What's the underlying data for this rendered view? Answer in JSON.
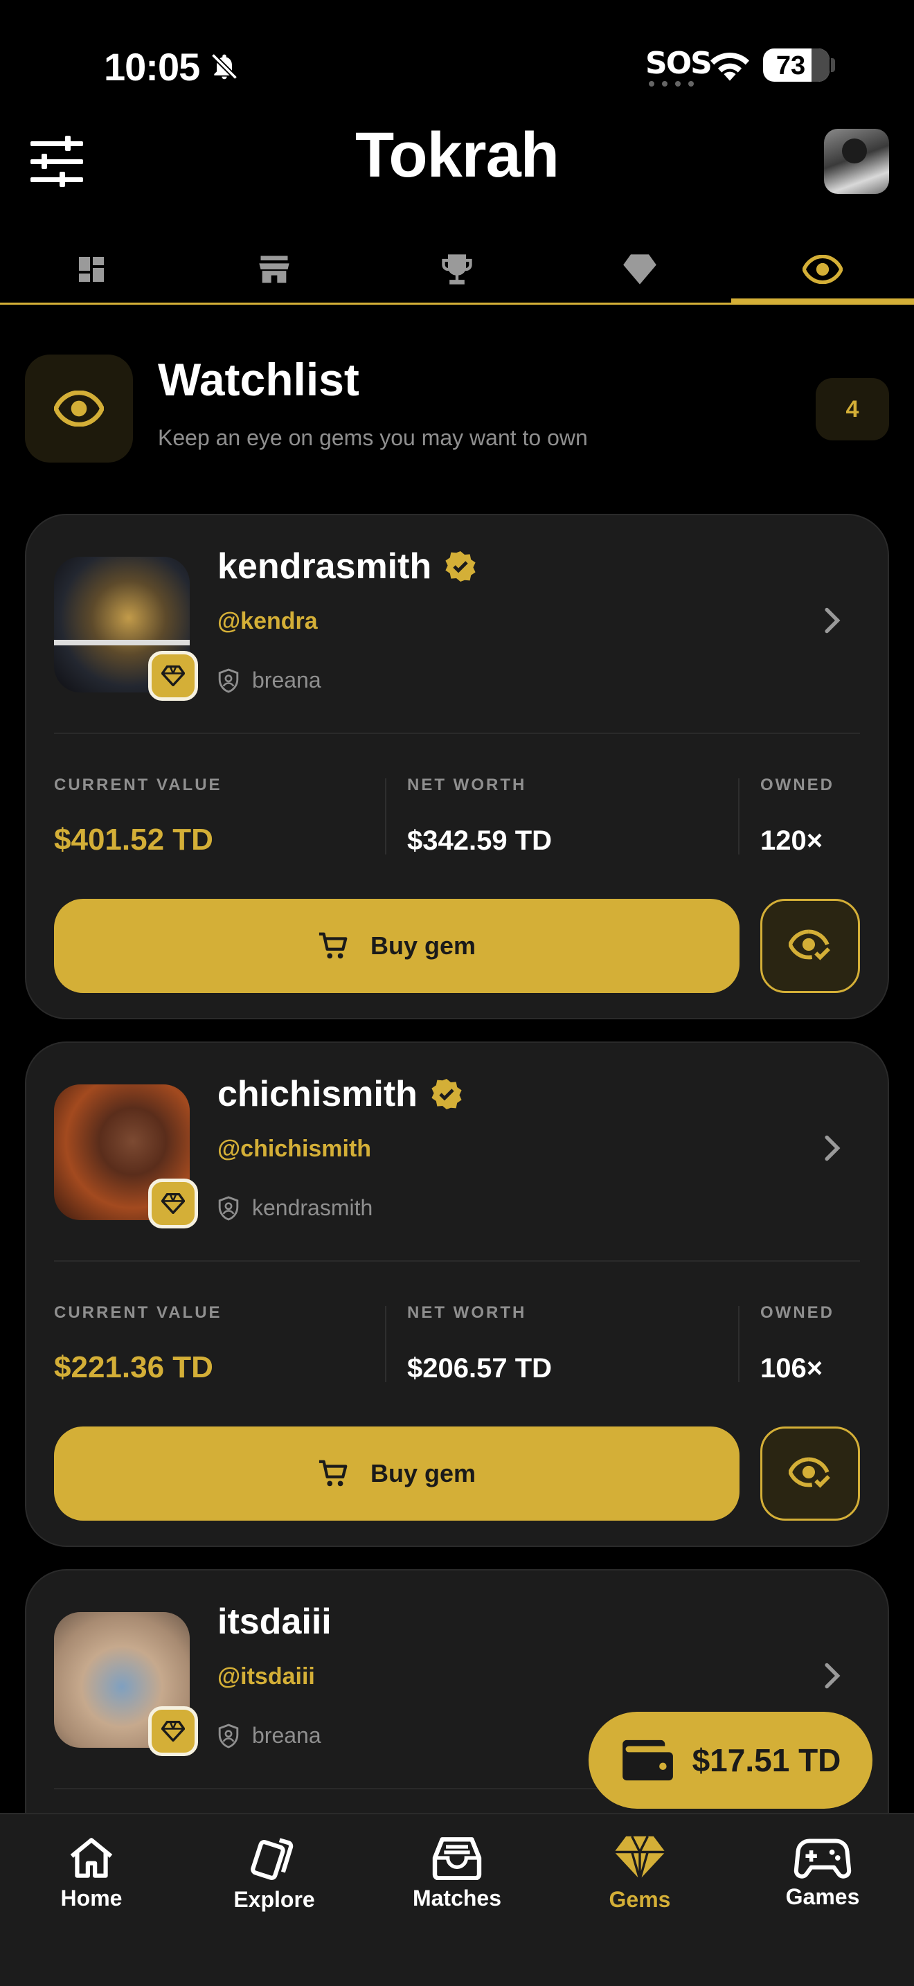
{
  "status_bar": {
    "time": "10:05",
    "sos": "SOS",
    "battery": "73"
  },
  "header": {
    "title": "Tokrah"
  },
  "top_tabs": [
    {
      "icon": "dashboard-icon"
    },
    {
      "icon": "store-icon"
    },
    {
      "icon": "trophy-icon"
    },
    {
      "icon": "diamond-icon"
    },
    {
      "icon": "eye-icon",
      "active": true
    }
  ],
  "watchlist": {
    "title": "Watchlist",
    "subtitle": "Keep an eye on gems you may want to own",
    "count": "4"
  },
  "stat_labels": {
    "current_value": "CURRENT VALUE",
    "net_worth": "NET WORTH",
    "owned": "OWNED"
  },
  "cards": [
    {
      "name": "kendrasmith",
      "verified": true,
      "handle": "@kendra",
      "owner": "breana",
      "current_value": "$401.52 TD",
      "net_worth": "$342.59 TD",
      "owned": "120×",
      "buy_label": "Buy gem"
    },
    {
      "name": "chichismith",
      "verified": true,
      "handle": "@chichismith",
      "owner": "kendrasmith",
      "current_value": "$221.36 TD",
      "net_worth": "$206.57 TD",
      "owned": "106×",
      "buy_label": "Buy gem"
    },
    {
      "name": "itsdaiii",
      "verified": false,
      "handle": "@itsdaiii",
      "owner": "breana"
    }
  ],
  "wallet": {
    "balance": "$17.51 TD"
  },
  "bottom_nav": [
    {
      "label": "Home",
      "icon": "home-icon"
    },
    {
      "label": "Explore",
      "icon": "cards-icon"
    },
    {
      "label": "Matches",
      "icon": "inbox-icon"
    },
    {
      "label": "Gems",
      "icon": "diamond-icon",
      "active": true
    },
    {
      "label": "Games",
      "icon": "gamepad-icon"
    }
  ],
  "colors": {
    "accent": "#d4af37",
    "background": "#000000",
    "card": "#1c1c1c",
    "muted": "#8f8f8f"
  }
}
